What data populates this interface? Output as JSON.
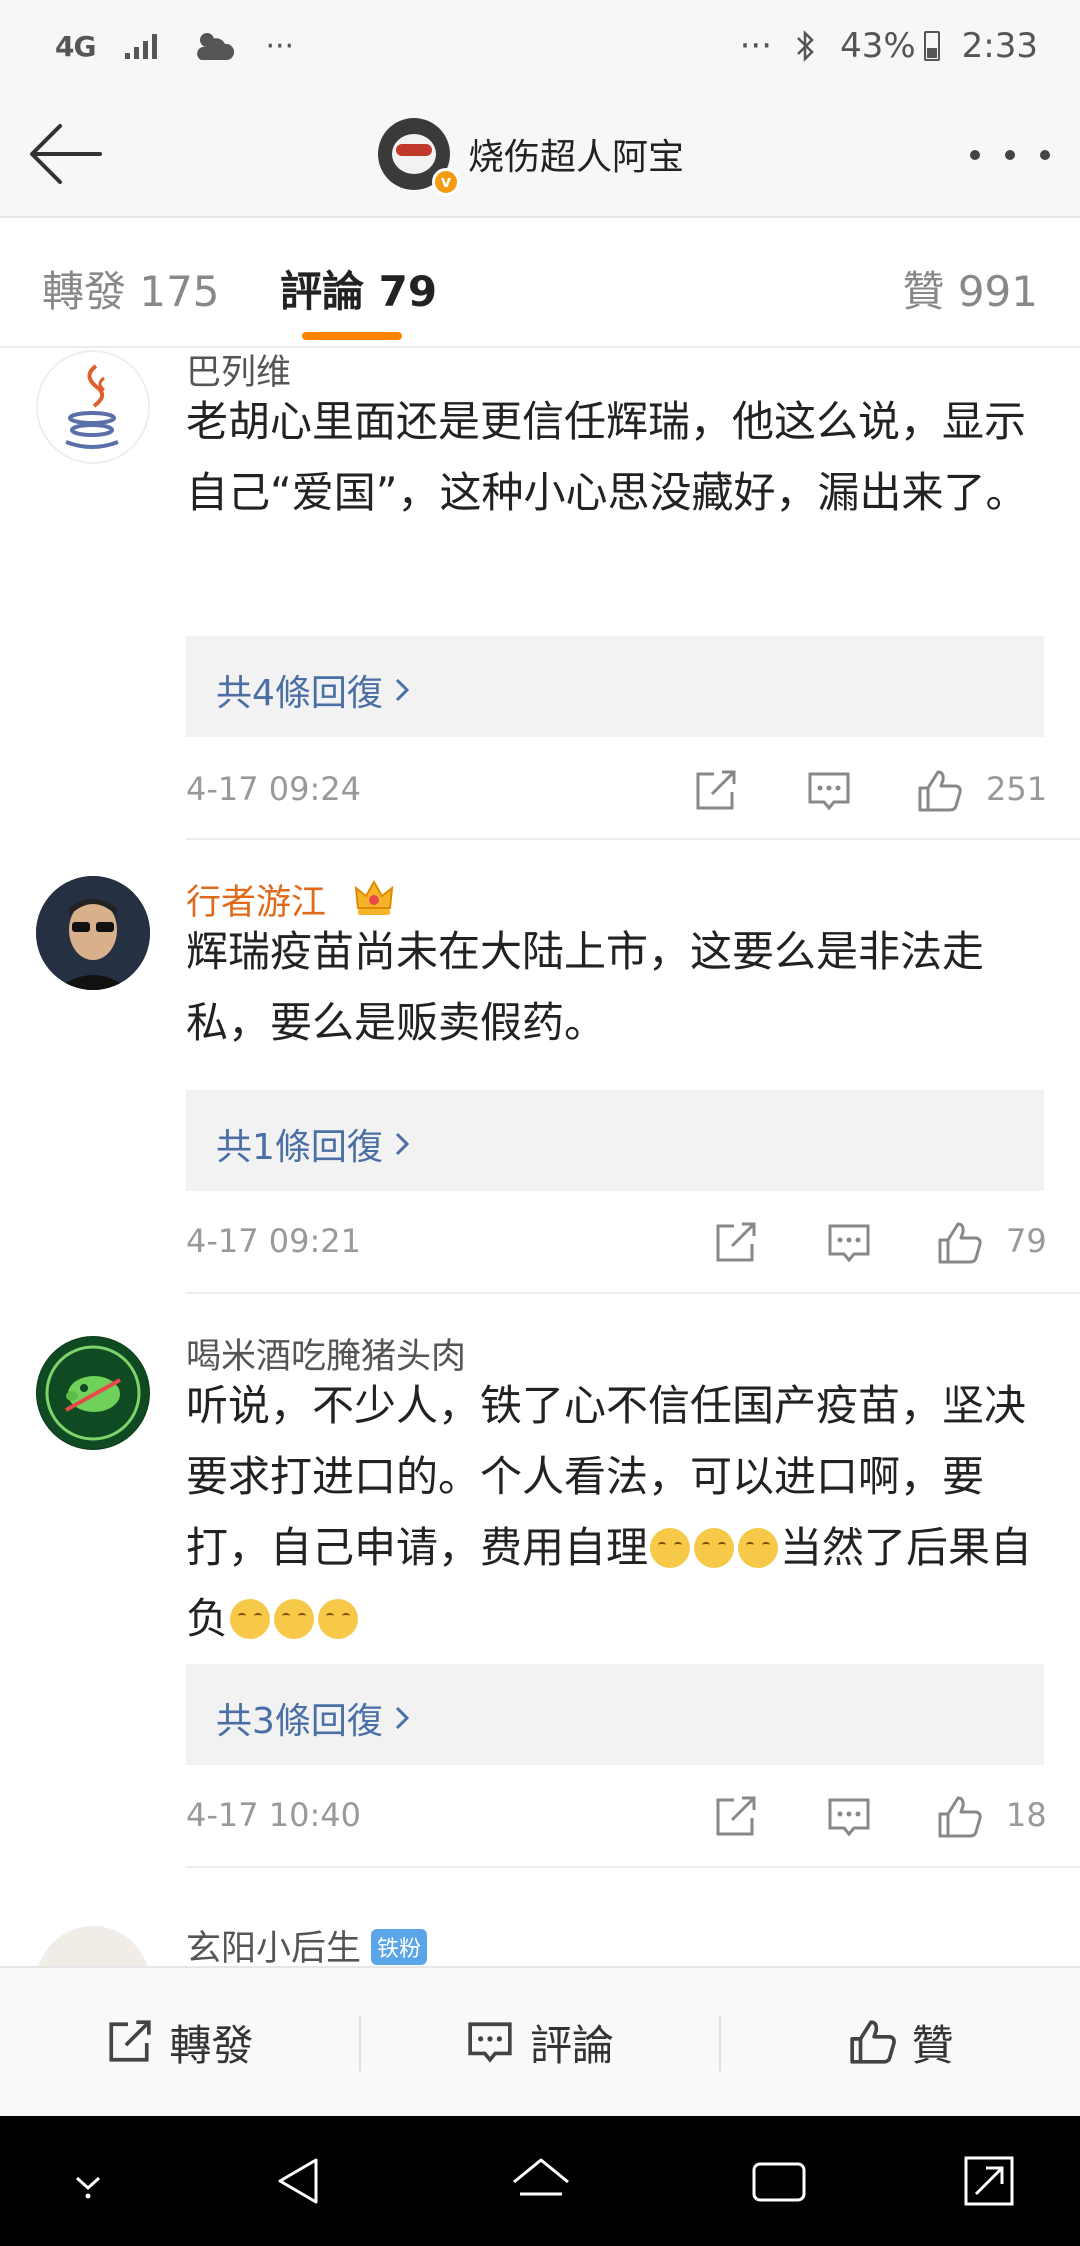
{
  "status_bar": {
    "network": "4G",
    "more_left": "···",
    "more_right": "···",
    "battery": "43%",
    "time": "2:33"
  },
  "header": {
    "title": "烧伤超人阿宝",
    "verified_badge": "v"
  },
  "tabs": [
    {
      "label": "轉發 175"
    },
    {
      "label": "評論 79"
    },
    {
      "label": "贊 991"
    }
  ],
  "accent_color": "#ff8200",
  "comments": [
    {
      "name": "巴列维",
      "text": "老胡心里面还是更信任辉瑞，他这么说，显示自己“爱国”，这种小心思没藏好，漏出来了。",
      "replies": "共4條回復",
      "time": "4-17 09:24",
      "likes": "251"
    },
    {
      "name": "行者游江",
      "text": "辉瑞疫苗尚未在大陆上市，这要么是非法走私，要么是贩卖假药。",
      "replies": "共1條回復",
      "time": "4-17 09:21",
      "likes": "79"
    },
    {
      "name": "喝米酒吃腌猪头肉",
      "text_part1": "听说，不少人，铁了心不信任国产疫苗，坚决要求打进口的。个人看法，可以进口啊，要打，自己申请，费用自理",
      "text_part2": "当然了后果自负",
      "replies": "共3條回復",
      "time": "4-17 10:40",
      "likes": "18"
    },
    {
      "name": "玄阳小后生",
      "badge": "铁粉"
    }
  ],
  "bottom_bar": {
    "repost": "轉發",
    "comment": "評論",
    "like": "贊"
  }
}
